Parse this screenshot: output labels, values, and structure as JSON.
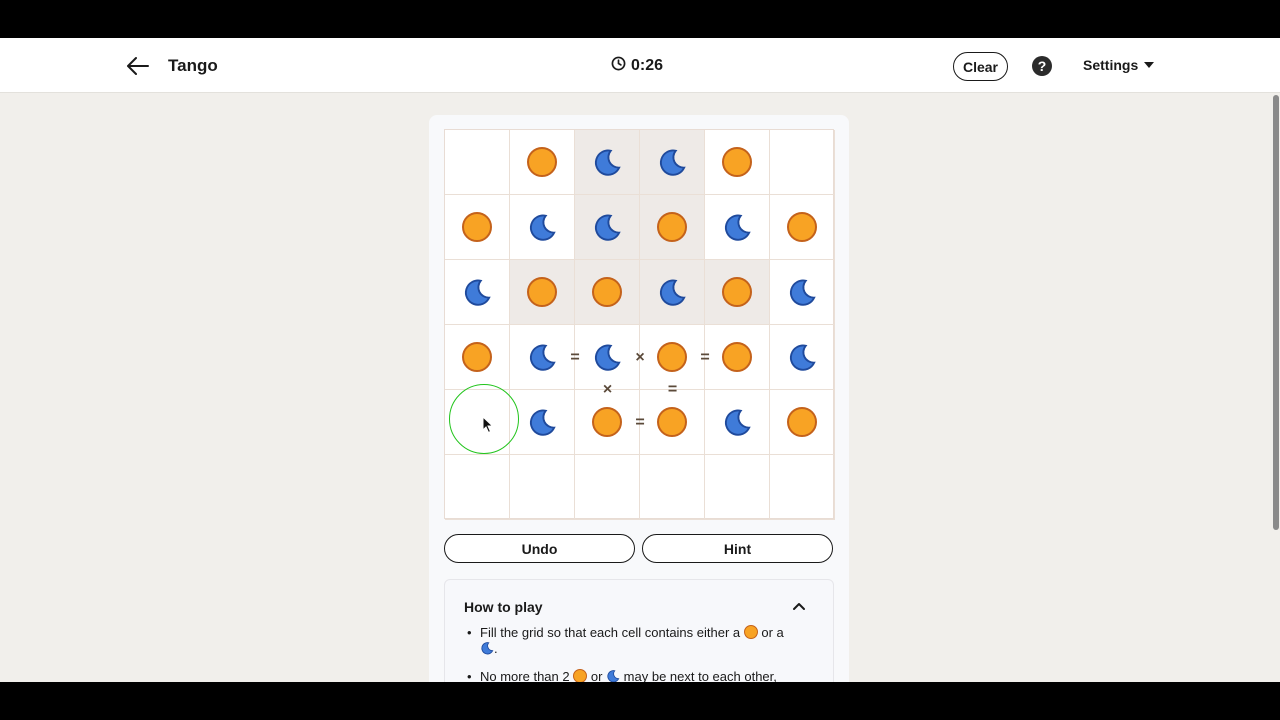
{
  "header": {
    "title": "Tango",
    "timer": "0:26",
    "clear_label": "Clear",
    "help_label": "?",
    "settings_label": "Settings"
  },
  "board": {
    "rows": [
      [
        "",
        "sun",
        "moon",
        "moon",
        "sun",
        ""
      ],
      [
        "sun",
        "moon",
        "moon",
        "sun",
        "moon",
        "sun"
      ],
      [
        "moon",
        "sun",
        "sun",
        "moon",
        "sun",
        "moon"
      ],
      [
        "sun",
        "moon",
        "moon",
        "sun",
        "sun",
        "moon"
      ],
      [
        "",
        "moon",
        "sun",
        "sun",
        "moon",
        "sun"
      ],
      [
        "",
        "",
        "",
        "",
        "",
        ""
      ]
    ],
    "locked": [
      [
        0,
        2
      ],
      [
        0,
        3
      ],
      [
        1,
        2
      ],
      [
        1,
        3
      ],
      [
        2,
        1
      ],
      [
        2,
        2
      ],
      [
        2,
        3
      ],
      [
        2,
        4
      ]
    ],
    "constraints": [
      {
        "between": [
          [
            3,
            1
          ],
          [
            3,
            2
          ]
        ],
        "symbol": "="
      },
      {
        "between": [
          [
            3,
            2
          ],
          [
            3,
            3
          ]
        ],
        "symbol": "×"
      },
      {
        "between": [
          [
            3,
            3
          ],
          [
            3,
            4
          ]
        ],
        "symbol": "="
      },
      {
        "between": [
          [
            3,
            2
          ],
          [
            4,
            2
          ]
        ],
        "symbol": "×"
      },
      {
        "between": [
          [
            3,
            3
          ],
          [
            4,
            3
          ]
        ],
        "symbol": "="
      },
      {
        "between": [
          [
            4,
            2
          ],
          [
            4,
            3
          ]
        ],
        "symbol": "="
      }
    ]
  },
  "actions": {
    "undo_label": "Undo",
    "hint_label": "Hint"
  },
  "howto": {
    "title": "How to play",
    "rule1_a": "Fill the grid so that each cell contains either a",
    "rule1_b": "or a",
    "rule1_c": ".",
    "rule2_a": "No more than 2",
    "rule2_b": "or",
    "rule2_c": "may be next to each other,"
  },
  "colors": {
    "sun_fill": "#f8a324",
    "sun_stroke": "#c4621b",
    "moon_fill": "#3f7bd9",
    "moon_stroke": "#1f4a9c",
    "locked_bg": "#eeeae7",
    "page_bg": "#f1efeb"
  }
}
